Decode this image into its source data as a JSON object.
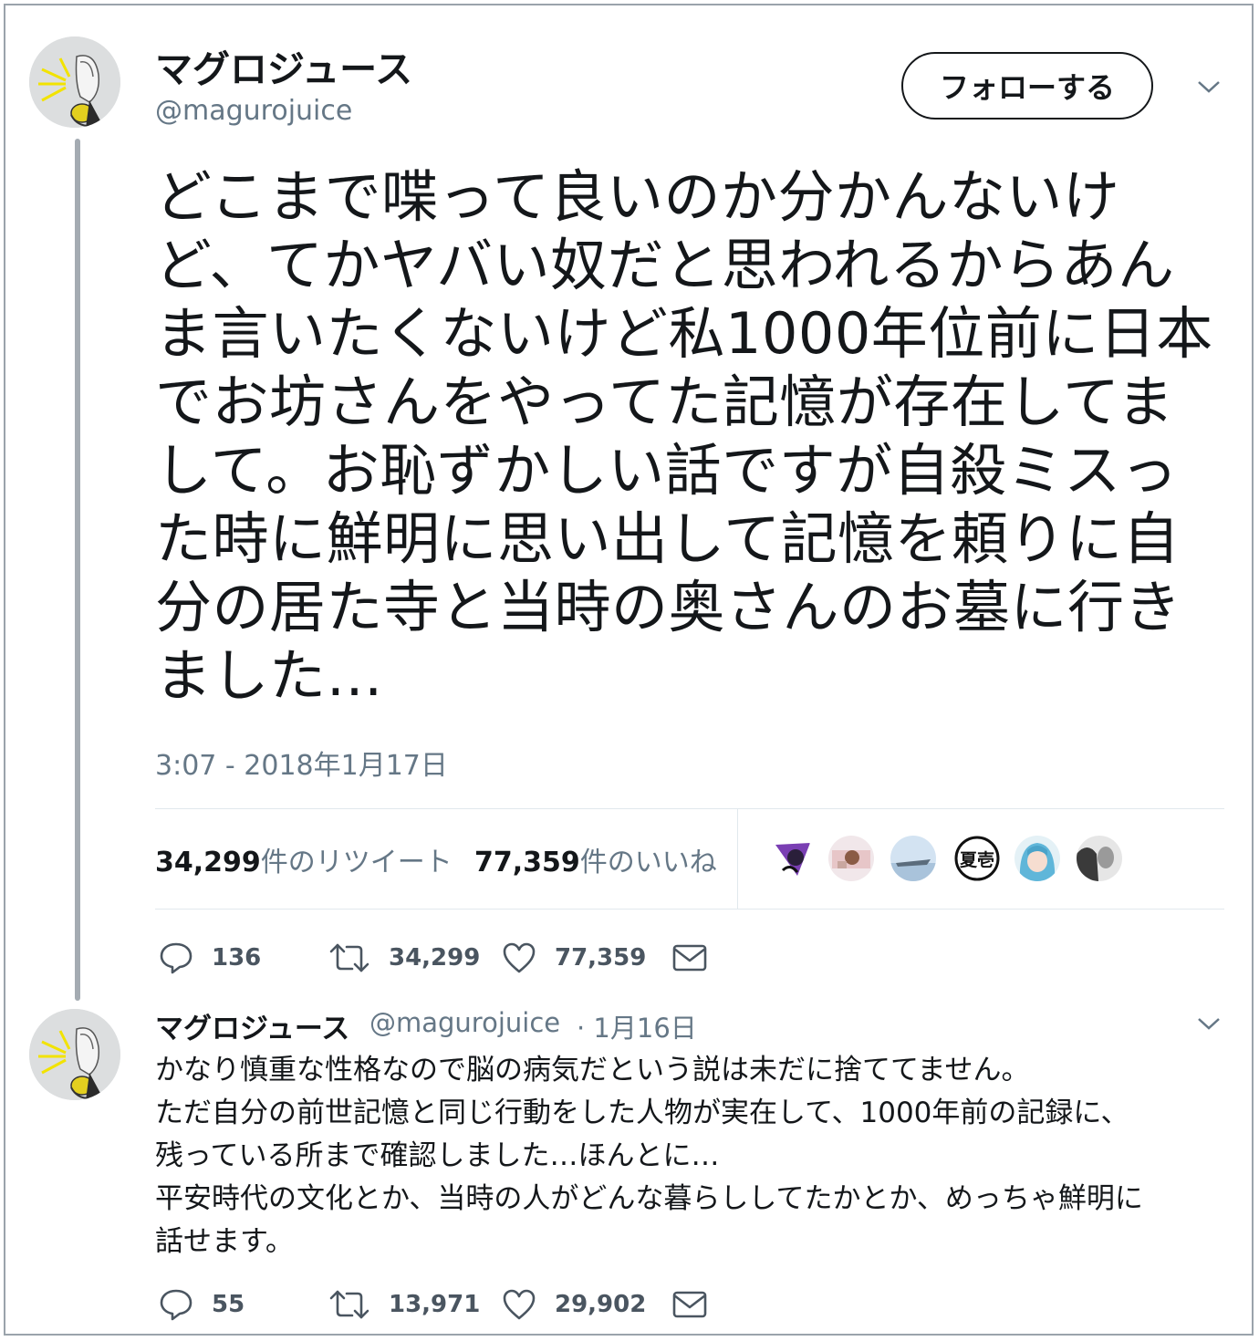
{
  "tweet": {
    "display_name": "マグロジュース",
    "handle": "@magurojuice",
    "follow_label": "フォローする",
    "text": "どこまで喋って良いのか分かんないけ\nど、てかヤバい奴だと思われるからあん\nま言いたくないけど私1000年位前に日本\nでお坊さんをやってた記憶が存在してま\nして。お恥ずかしい話ですが自殺ミスっ\nた時に鮮明に思い出して記憶を頼りに自\n分の居た寺と当時の奥さんのお墓に行き\nました…",
    "timestamp": "3:07 - 2018年1月17日",
    "retweet_count": "34,299",
    "retweet_label": "件のリツイート",
    "like_count": "77,359",
    "like_label": "件のいいね",
    "liker_mini_avatar_text": "夏壱",
    "actions": {
      "replies": "136",
      "retweets": "34,299",
      "likes": "77,359"
    }
  },
  "reply": {
    "display_name": "マグロジュース",
    "handle": "@magurojuice",
    "date": "· 1月16日",
    "text": "かなり慎重な性格なので脳の病気だという説は未だに捨ててません。\nただ自分の前世記憶と同じ行動をした人物が実在して、1000年前の記録に、\n残っている所まで確認しました…ほんとに…\n平安時代の文化とか、当時の人がどんな暮らししてたかとか、めっちゃ鮮明に\n話せます。",
    "actions": {
      "replies": "55",
      "retweets": "13,971",
      "likes": "29,902"
    }
  },
  "colors": {
    "text": "#14171a",
    "secondary": "#657786",
    "divider": "#e1e8ed",
    "thread_line": "#a4abb2"
  }
}
